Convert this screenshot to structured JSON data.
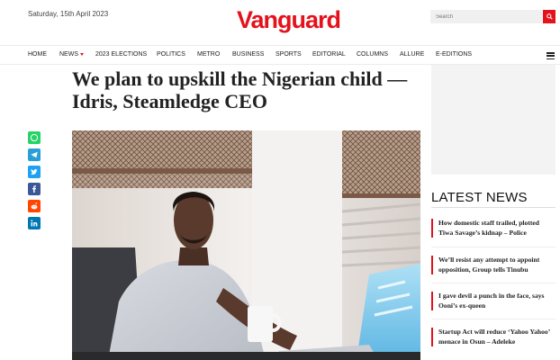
{
  "header": {
    "date": "Saturday, 15th April 2023",
    "logo": "Vanguard",
    "search_placeholder": "Search"
  },
  "nav": {
    "items": [
      "HOME",
      "NEWS",
      "2023 ELECTIONS",
      "POLITICS",
      "METRO",
      "BUSINESS",
      "SPORTS",
      "EDITORIAL",
      "COLUMNS",
      "ALLURE",
      "E-EDITIONS"
    ]
  },
  "article": {
    "headline": "We plan to upskill the Nigerian child — Idris, Steamledge CEO"
  },
  "share": {
    "icons": [
      "whatsapp-icon",
      "telegram-icon",
      "twitter-icon",
      "facebook-icon",
      "reddit-icon",
      "linkedin-icon"
    ],
    "colors": [
      "#25d366",
      "#2a9fd6",
      "#1da1f2",
      "#3b5998",
      "#ff4500",
      "#0077b5"
    ]
  },
  "sidebar": {
    "latest_title": "LATEST NEWS",
    "news": [
      "How domestic staff trailed, plotted Tiwa Savage’s kidnap – Police",
      "We’ll resist any attempt to appoint opposition, Group tells Tinubu",
      "I gave devil a punch in the face, says Ooni’s ex-queen",
      "Startup Act will reduce ‘Yahoo Yahoo’ menace in Osun – Adeleke"
    ]
  },
  "colors": {
    "brand": "#e3121b"
  }
}
